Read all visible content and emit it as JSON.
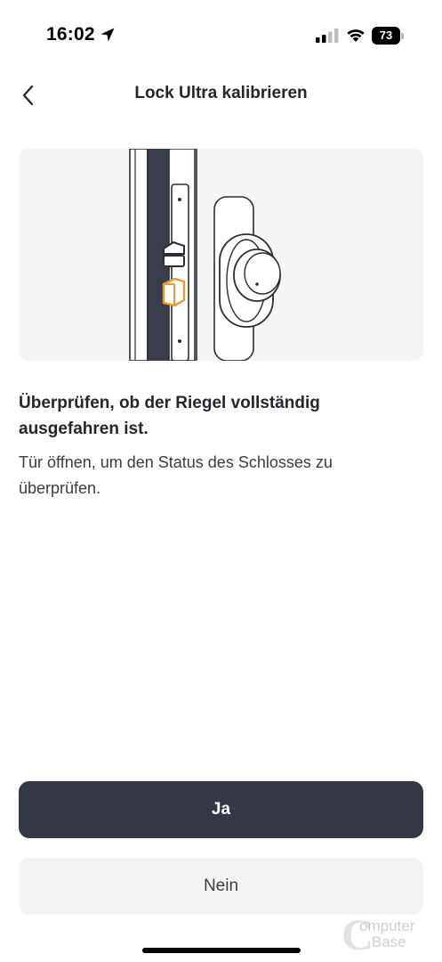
{
  "status_bar": {
    "time": "16:02",
    "battery": "73",
    "icons": [
      "location-arrow-icon",
      "cellular-signal-icon",
      "wifi-icon",
      "battery-icon"
    ]
  },
  "header": {
    "title": "Lock Ultra kalibrieren",
    "back_icon": "chevron-left-icon"
  },
  "illustration": {
    "subject": "door-lock-bolt-illustration",
    "accent_color": "#f0962e"
  },
  "instruction": {
    "heading": "Überprüfen, ob der Riegel vollständig ausgefahren ist.",
    "body": "Tür öffnen, um den Status des Schlosses zu überprüfen."
  },
  "actions": {
    "yes_label": "Ja",
    "no_label": "Nein"
  },
  "watermark": {
    "letter": "C",
    "line1": "omputer",
    "line2": "Base"
  },
  "colors": {
    "primary_button": "#343845",
    "secondary_button": "#f4f4f5",
    "text": "#24262c",
    "card_background": "#f5f5f6"
  }
}
